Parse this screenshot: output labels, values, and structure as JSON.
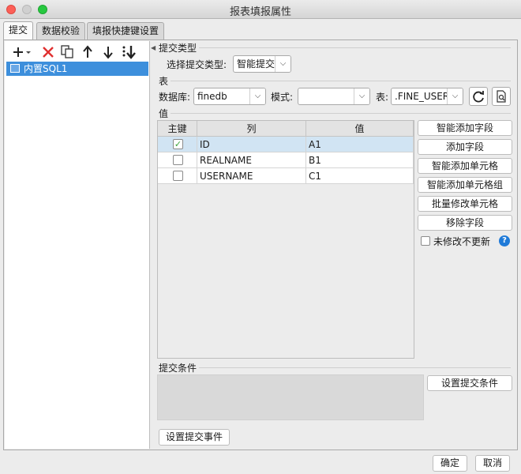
{
  "window": {
    "title": "报表填报属性"
  },
  "tabs": [
    {
      "label": "提交"
    },
    {
      "label": "数据校验"
    },
    {
      "label": "填报快捷键设置"
    }
  ],
  "left_panel": {
    "items": [
      {
        "label": "内置SQL1"
      }
    ]
  },
  "submit_type": {
    "group_label": "提交类型",
    "field_label": "选择提交类型:",
    "value": "智能提交"
  },
  "table_section": {
    "group_label": "表",
    "db_label": "数据库:",
    "db_value": "finedb",
    "schema_label": "模式:",
    "schema_value": "",
    "table_label": "表:",
    "table_value": ".FINE_USER"
  },
  "values": {
    "group_label": "值",
    "headers": [
      "主键",
      "列",
      "值"
    ],
    "rows": [
      {
        "key": true,
        "column": "ID",
        "value": "A1"
      },
      {
        "key": false,
        "column": "REALNAME",
        "value": "B1"
      },
      {
        "key": false,
        "column": "USERNAME",
        "value": "C1"
      }
    ],
    "buttons": [
      "智能添加字段",
      "添加字段",
      "智能添加单元格",
      "智能添加单元格组",
      "批量修改单元格",
      "移除字段"
    ],
    "no_update_label": "未修改不更新"
  },
  "condition": {
    "group_label": "提交条件",
    "set_button": "设置提交条件"
  },
  "event_button": "设置提交事件",
  "footer": {
    "ok": "确定",
    "cancel": "取消"
  },
  "colors": {
    "selection": "#3d8fdc",
    "row_selected": "#d1e4f3",
    "delete_icon": "#e03030",
    "help": "#1f7ad8"
  }
}
